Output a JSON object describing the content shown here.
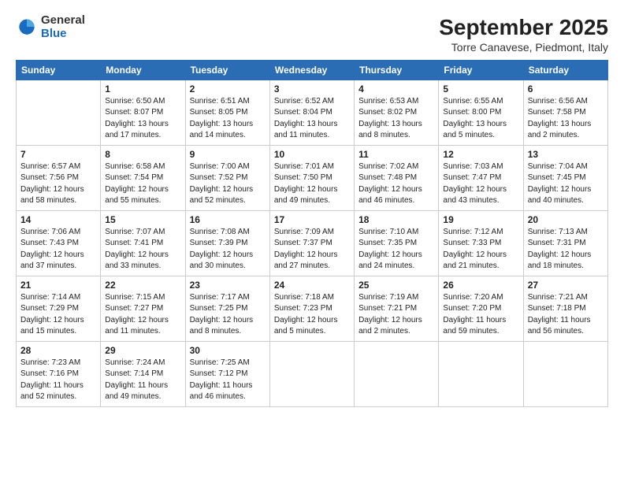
{
  "header": {
    "logo": {
      "general": "General",
      "blue": "Blue"
    },
    "title": "September 2025",
    "location": "Torre Canavese, Piedmont, Italy"
  },
  "weekdays": [
    "Sunday",
    "Monday",
    "Tuesday",
    "Wednesday",
    "Thursday",
    "Friday",
    "Saturday"
  ],
  "weeks": [
    [
      {
        "day": null
      },
      {
        "day": 1,
        "sunrise": "6:50 AM",
        "sunset": "8:07 PM",
        "daylight": "13 hours and 17 minutes."
      },
      {
        "day": 2,
        "sunrise": "6:51 AM",
        "sunset": "8:05 PM",
        "daylight": "13 hours and 14 minutes."
      },
      {
        "day": 3,
        "sunrise": "6:52 AM",
        "sunset": "8:04 PM",
        "daylight": "13 hours and 11 minutes."
      },
      {
        "day": 4,
        "sunrise": "6:53 AM",
        "sunset": "8:02 PM",
        "daylight": "13 hours and 8 minutes."
      },
      {
        "day": 5,
        "sunrise": "6:55 AM",
        "sunset": "8:00 PM",
        "daylight": "13 hours and 5 minutes."
      },
      {
        "day": 6,
        "sunrise": "6:56 AM",
        "sunset": "7:58 PM",
        "daylight": "13 hours and 2 minutes."
      }
    ],
    [
      {
        "day": 7,
        "sunrise": "6:57 AM",
        "sunset": "7:56 PM",
        "daylight": "12 hours and 58 minutes."
      },
      {
        "day": 8,
        "sunrise": "6:58 AM",
        "sunset": "7:54 PM",
        "daylight": "12 hours and 55 minutes."
      },
      {
        "day": 9,
        "sunrise": "7:00 AM",
        "sunset": "7:52 PM",
        "daylight": "12 hours and 52 minutes."
      },
      {
        "day": 10,
        "sunrise": "7:01 AM",
        "sunset": "7:50 PM",
        "daylight": "12 hours and 49 minutes."
      },
      {
        "day": 11,
        "sunrise": "7:02 AM",
        "sunset": "7:48 PM",
        "daylight": "12 hours and 46 minutes."
      },
      {
        "day": 12,
        "sunrise": "7:03 AM",
        "sunset": "7:47 PM",
        "daylight": "12 hours and 43 minutes."
      },
      {
        "day": 13,
        "sunrise": "7:04 AM",
        "sunset": "7:45 PM",
        "daylight": "12 hours and 40 minutes."
      }
    ],
    [
      {
        "day": 14,
        "sunrise": "7:06 AM",
        "sunset": "7:43 PM",
        "daylight": "12 hours and 37 minutes."
      },
      {
        "day": 15,
        "sunrise": "7:07 AM",
        "sunset": "7:41 PM",
        "daylight": "12 hours and 33 minutes."
      },
      {
        "day": 16,
        "sunrise": "7:08 AM",
        "sunset": "7:39 PM",
        "daylight": "12 hours and 30 minutes."
      },
      {
        "day": 17,
        "sunrise": "7:09 AM",
        "sunset": "7:37 PM",
        "daylight": "12 hours and 27 minutes."
      },
      {
        "day": 18,
        "sunrise": "7:10 AM",
        "sunset": "7:35 PM",
        "daylight": "12 hours and 24 minutes."
      },
      {
        "day": 19,
        "sunrise": "7:12 AM",
        "sunset": "7:33 PM",
        "daylight": "12 hours and 21 minutes."
      },
      {
        "day": 20,
        "sunrise": "7:13 AM",
        "sunset": "7:31 PM",
        "daylight": "12 hours and 18 minutes."
      }
    ],
    [
      {
        "day": 21,
        "sunrise": "7:14 AM",
        "sunset": "7:29 PM",
        "daylight": "12 hours and 15 minutes."
      },
      {
        "day": 22,
        "sunrise": "7:15 AM",
        "sunset": "7:27 PM",
        "daylight": "12 hours and 11 minutes."
      },
      {
        "day": 23,
        "sunrise": "7:17 AM",
        "sunset": "7:25 PM",
        "daylight": "12 hours and 8 minutes."
      },
      {
        "day": 24,
        "sunrise": "7:18 AM",
        "sunset": "7:23 PM",
        "daylight": "12 hours and 5 minutes."
      },
      {
        "day": 25,
        "sunrise": "7:19 AM",
        "sunset": "7:21 PM",
        "daylight": "12 hours and 2 minutes."
      },
      {
        "day": 26,
        "sunrise": "7:20 AM",
        "sunset": "7:20 PM",
        "daylight": "11 hours and 59 minutes."
      },
      {
        "day": 27,
        "sunrise": "7:21 AM",
        "sunset": "7:18 PM",
        "daylight": "11 hours and 56 minutes."
      }
    ],
    [
      {
        "day": 28,
        "sunrise": "7:23 AM",
        "sunset": "7:16 PM",
        "daylight": "11 hours and 52 minutes."
      },
      {
        "day": 29,
        "sunrise": "7:24 AM",
        "sunset": "7:14 PM",
        "daylight": "11 hours and 49 minutes."
      },
      {
        "day": 30,
        "sunrise": "7:25 AM",
        "sunset": "7:12 PM",
        "daylight": "11 hours and 46 minutes."
      },
      {
        "day": null
      },
      {
        "day": null
      },
      {
        "day": null
      },
      {
        "day": null
      }
    ]
  ]
}
